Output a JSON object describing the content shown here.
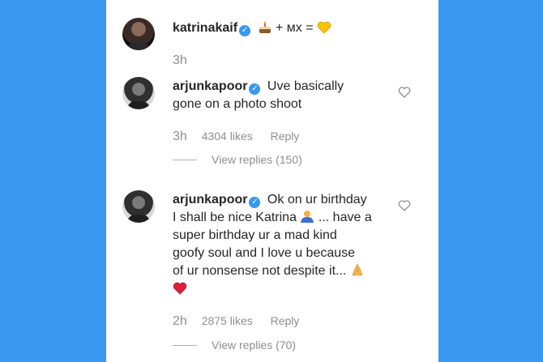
{
  "caption": {
    "username": "katrinakaif",
    "text_after_cake": "+ мх =",
    "time": "3h",
    "icons": [
      "verified-badge",
      "cake-emoji",
      "yellow-heart-emoji"
    ]
  },
  "comments": [
    {
      "username": "arjunkapoor",
      "lines": [
        "Uve basically",
        "gone on a photo shoot"
      ],
      "time": "3h",
      "likes": "4304 likes",
      "reply": "Reply",
      "view_replies": "View replies (150)"
    },
    {
      "username": "arjunkapoor",
      "lines": [
        "Ok on ur birthday",
        "I shall be nice Katrina",
        "... have a",
        "super birthday ur a mad kind",
        "goofy soul and I love u because",
        "of ur nonsense not despite it..."
      ],
      "emojis": [
        "person-shrugging-emoji",
        "folded-hands-emoji",
        "red-heart-emoji"
      ],
      "time": "2h",
      "likes": "2875 likes",
      "reply": "Reply",
      "view_replies": "View replies (70)"
    }
  ],
  "colors": {
    "background": "#3a98f0",
    "panel": "#ffffff",
    "text": "#262626",
    "muted": "#8e8e8e",
    "verified": "#3897f0"
  }
}
